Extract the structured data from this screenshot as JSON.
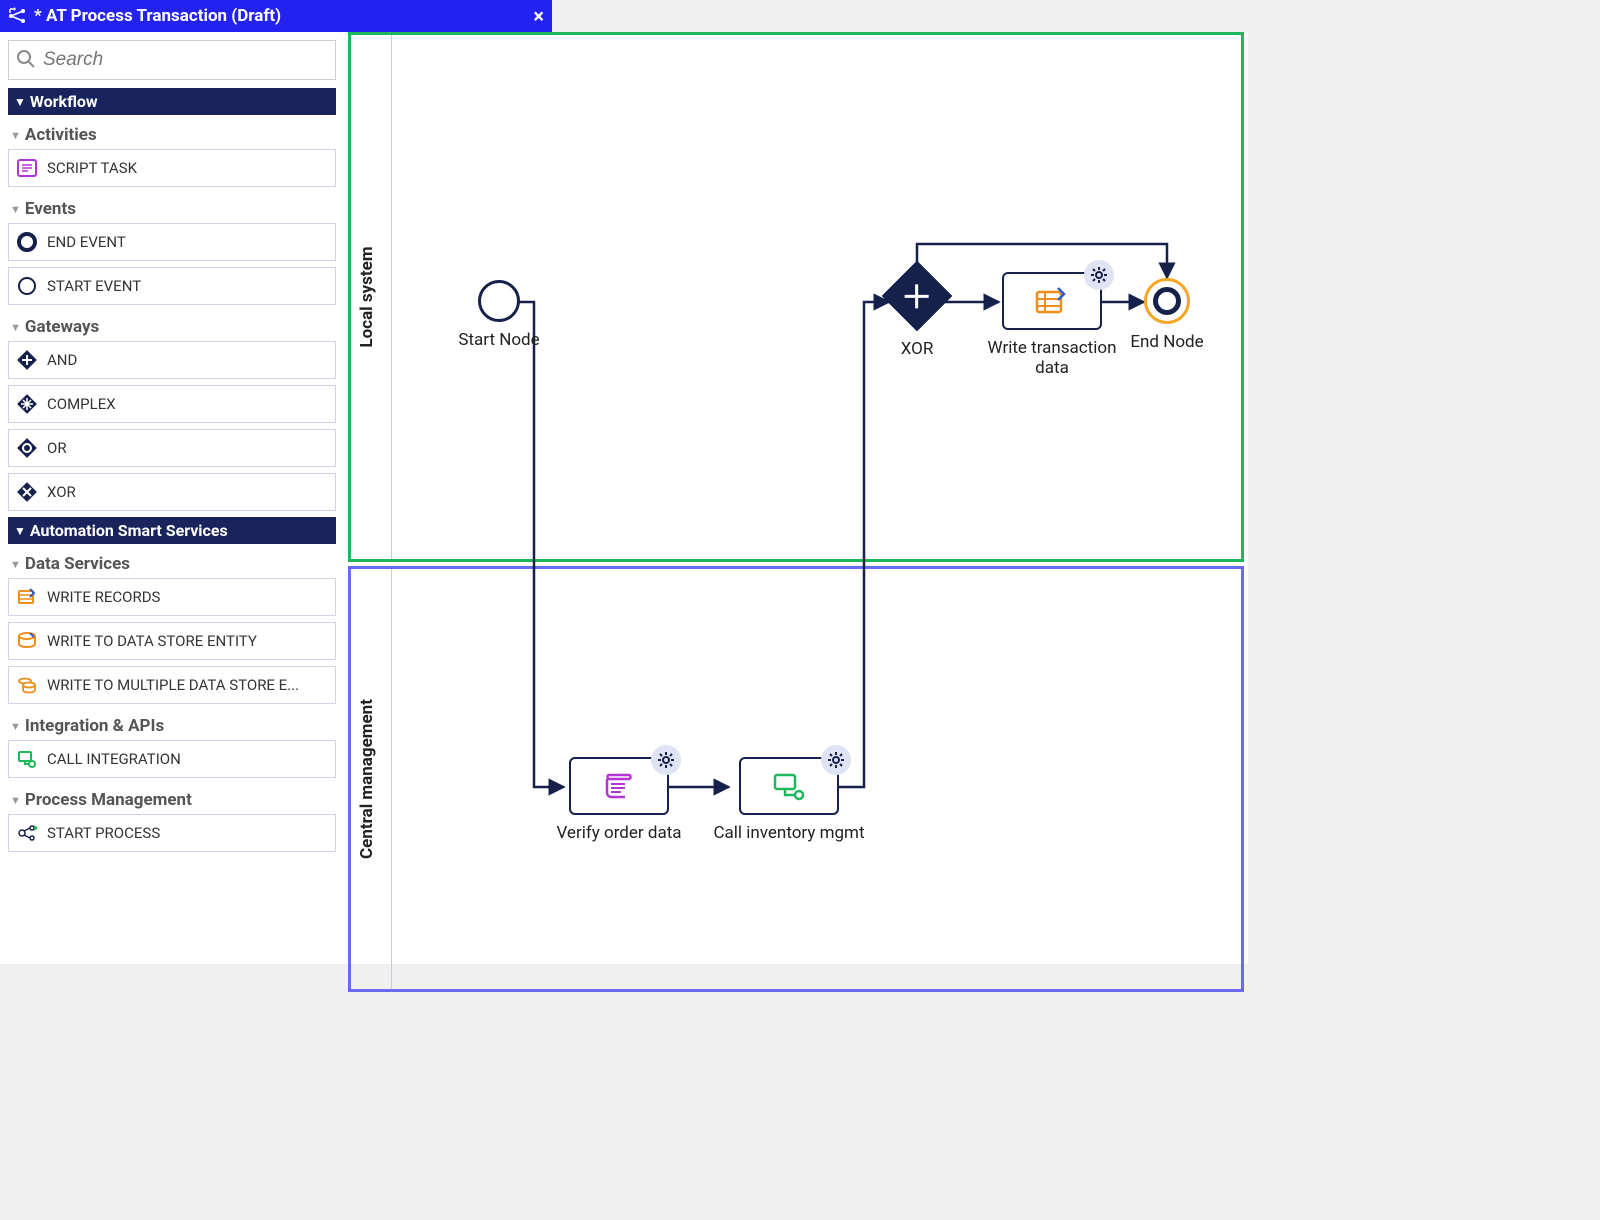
{
  "titlebar": {
    "title": "* AT Process Transaction (Draft)"
  },
  "search": {
    "placeholder": "Search"
  },
  "sections": [
    {
      "title": "Workflow",
      "groups": [
        {
          "title": "Activities",
          "items": [
            {
              "label": "SCRIPT TASK",
              "icon": "script"
            }
          ]
        },
        {
          "title": "Events",
          "items": [
            {
              "label": "END EVENT",
              "icon": "end"
            },
            {
              "label": "START EVENT",
              "icon": "start"
            }
          ]
        },
        {
          "title": "Gateways",
          "items": [
            {
              "label": "AND",
              "icon": "and"
            },
            {
              "label": "COMPLEX",
              "icon": "complex"
            },
            {
              "label": "OR",
              "icon": "or"
            },
            {
              "label": "XOR",
              "icon": "xor"
            }
          ]
        }
      ]
    },
    {
      "title": "Automation Smart Services",
      "groups": [
        {
          "title": "Data Services",
          "items": [
            {
              "label": "WRITE RECORDS",
              "icon": "write-records"
            },
            {
              "label": "WRITE TO DATA STORE ENTITY",
              "icon": "dse"
            },
            {
              "label": "WRITE TO MULTIPLE DATA STORE E...",
              "icon": "multi-dse"
            }
          ]
        },
        {
          "title": "Integration & APIs",
          "items": [
            {
              "label": "CALL INTEGRATION",
              "icon": "integration"
            }
          ]
        },
        {
          "title": "Process Management",
          "items": [
            {
              "label": "START PROCESS",
              "icon": "start-process"
            }
          ]
        }
      ]
    }
  ],
  "lanes": {
    "top": "Local system",
    "bottom": "Central management"
  },
  "nodes": {
    "start": "Start Node",
    "xor": "XOR",
    "write_txn": "Write transaction data",
    "end": "End Node",
    "verify": "Verify order data",
    "inventory": "Call inventory mgmt"
  }
}
